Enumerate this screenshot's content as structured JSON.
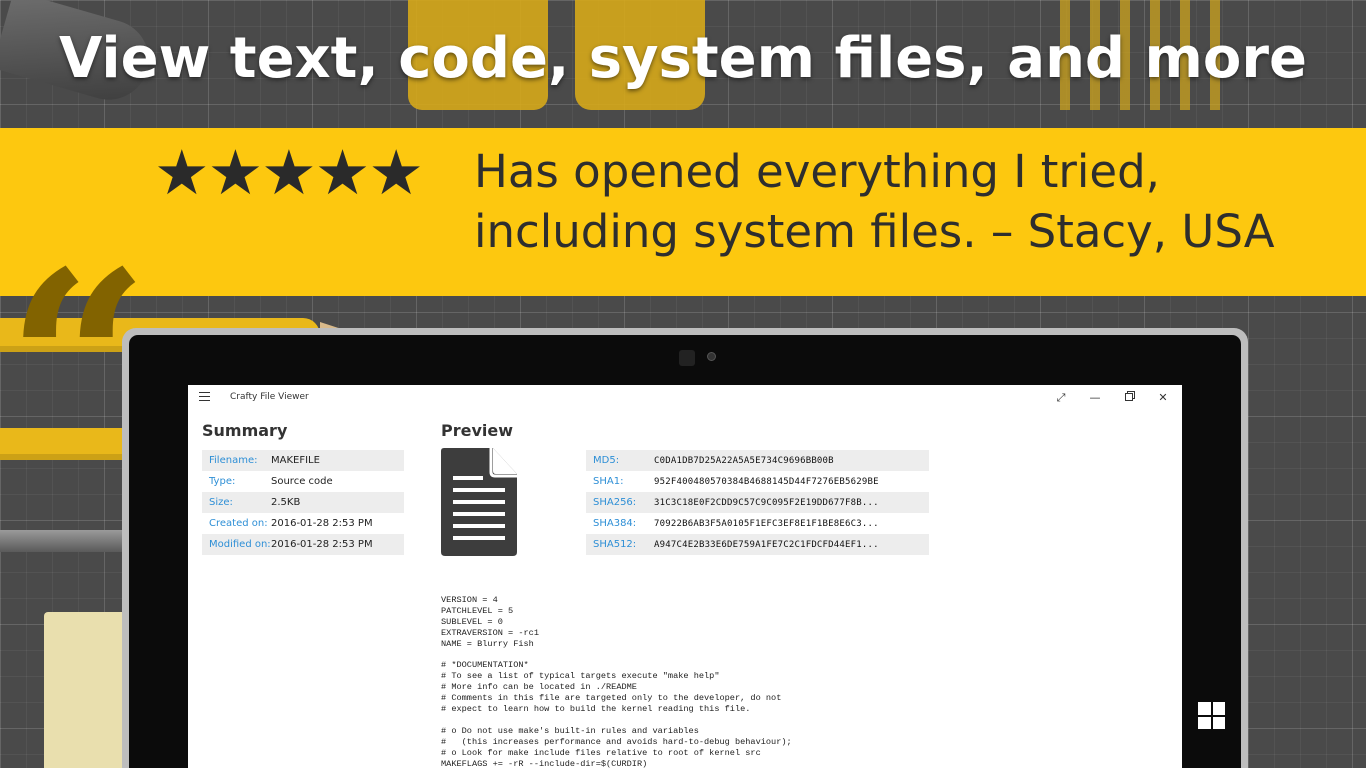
{
  "headline": "View text, code, system files, and more",
  "banner": {
    "stars": "★★★★★",
    "quote": "Has opened everything I tried, including system files. – Stacy, USA"
  },
  "app": {
    "title": "Crafty File Viewer",
    "window_buttons": {
      "expand": "⤢",
      "minimize": "—",
      "close": "✕"
    },
    "summary": {
      "title": "Summary",
      "rows": [
        {
          "key": "Filename:",
          "value": "MAKEFILE"
        },
        {
          "key": "Type:",
          "value": "Source code"
        },
        {
          "key": "Size:",
          "value": "2.5KB"
        },
        {
          "key": "Created on:",
          "value": "2016-01-28 2:53 PM"
        },
        {
          "key": "Modified on:",
          "value": "2016-01-28 2:53 PM"
        }
      ]
    },
    "preview": {
      "title": "Preview",
      "hashes": [
        {
          "key": "MD5:",
          "value": "C0DA1DB7D25A22A5A5E734C9696BB00B"
        },
        {
          "key": "SHA1:",
          "value": "952F400480570384B4688145D44F7276EB5629BE"
        },
        {
          "key": "SHA256:",
          "value": "31C3C18E0F2CDD9C57C9C095F2E19DD677F8B..."
        },
        {
          "key": "SHA384:",
          "value": "70922B6AB3F5A0105F1EFC3EF8E1F1BE8E6C3..."
        },
        {
          "key": "SHA512:",
          "value": "A947C4E2B33E6DE759A1FE7C2C1FDCFD44EF1..."
        }
      ],
      "code_lines": [
        "VERSION = 4",
        "PATCHLEVEL = 5",
        "SUBLEVEL = 0",
        "EXTRAVERSION = -rc1",
        "NAME = Blurry Fish",
        "",
        "# *DOCUMENTATION*",
        "# To see a list of typical targets execute \"make help\"",
        "# More info can be located in ./README",
        "# Comments in this file are targeted only to the developer, do not",
        "# expect to learn how to build the kernel reading this file.",
        "",
        "# o Do not use make's built-in rules and variables",
        "#   (this increases performance and avoids hard-to-debug behaviour);",
        "# o Look for make include files relative to root of kernel src",
        "MAKEFLAGS += -rR --include-dir=$(CURDIR)"
      ]
    }
  },
  "colors": {
    "banner": "#fdc80f",
    "accent_key": "#2e8fd6",
    "quote_mark": "#826300"
  }
}
